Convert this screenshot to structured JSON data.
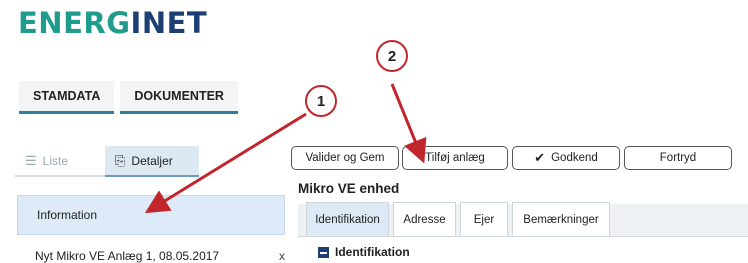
{
  "logo": {
    "part1": "ENERG",
    "part2": "INET"
  },
  "top_tabs": [
    "STAMDATA",
    "DOKUMENTER"
  ],
  "left_tabs": {
    "list_label": "Liste",
    "details_label": "Detaljer"
  },
  "left_items": {
    "information": "Information",
    "anlaeg": "Nyt Mikro VE Anlæg 1, 08.05.2017",
    "close": "x"
  },
  "actions": {
    "validate": "Valider og Gem",
    "add": "Tilføj anlæg",
    "approve": "Godkend",
    "cancel": "Fortryd"
  },
  "section_title": "Mikro VE enhed",
  "sub_tabs": [
    "Identifikation",
    "Adresse",
    "Ejer",
    "Bemærkninger"
  ],
  "section_header": "Identifikation",
  "callouts": [
    "1",
    "2"
  ],
  "colors": {
    "accent_teal": "#1f9c8c",
    "navy": "#1d3f73",
    "callout_red": "#c0262c"
  }
}
